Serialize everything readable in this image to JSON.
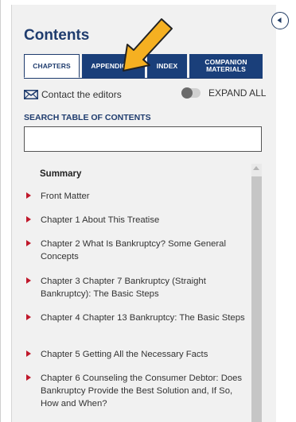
{
  "title": "Contents",
  "tabs": [
    {
      "label": "CHAPTERS",
      "active": true
    },
    {
      "label": "APPENDICES",
      "active": false
    },
    {
      "label": "INDEX",
      "active": false
    },
    {
      "label": "COMPANION MATERIALS",
      "active": false
    }
  ],
  "contact_label": "Contact the editors",
  "expand_all_label": "EXPAND ALL",
  "expand_all_on": false,
  "search": {
    "label": "SEARCH TABLE OF CONTENTS",
    "value": "",
    "placeholder": ""
  },
  "summary_label": "Summary",
  "items": [
    {
      "label": "Front Matter"
    },
    {
      "label": "Chapter 1 About This Treatise"
    },
    {
      "label": "Chapter 2 What Is Bankruptcy? Some General Concepts"
    },
    {
      "label": "Chapter 3 Chapter 7 Bankruptcy (Straight Bankruptcy): The Basic Steps"
    },
    {
      "label": "Chapter 4 Chapter 13 Bankruptcy: The Basic Steps"
    },
    {
      "label": "Chapter 5 Getting All the Necessary Facts"
    },
    {
      "label": "Chapter 6 Counseling the Consumer Debtor: Does Bankruptcy Provide the Best Solution and, If So, How and When?"
    }
  ],
  "colors": {
    "brand_navy": "#1a3f7a",
    "bullet_red": "#c0182b",
    "pointer_orange": "#f5b021"
  },
  "icons": {
    "collapse": "chevron-left-circle-icon",
    "contact": "envelope-icon",
    "bullet": "caret-right-icon"
  }
}
